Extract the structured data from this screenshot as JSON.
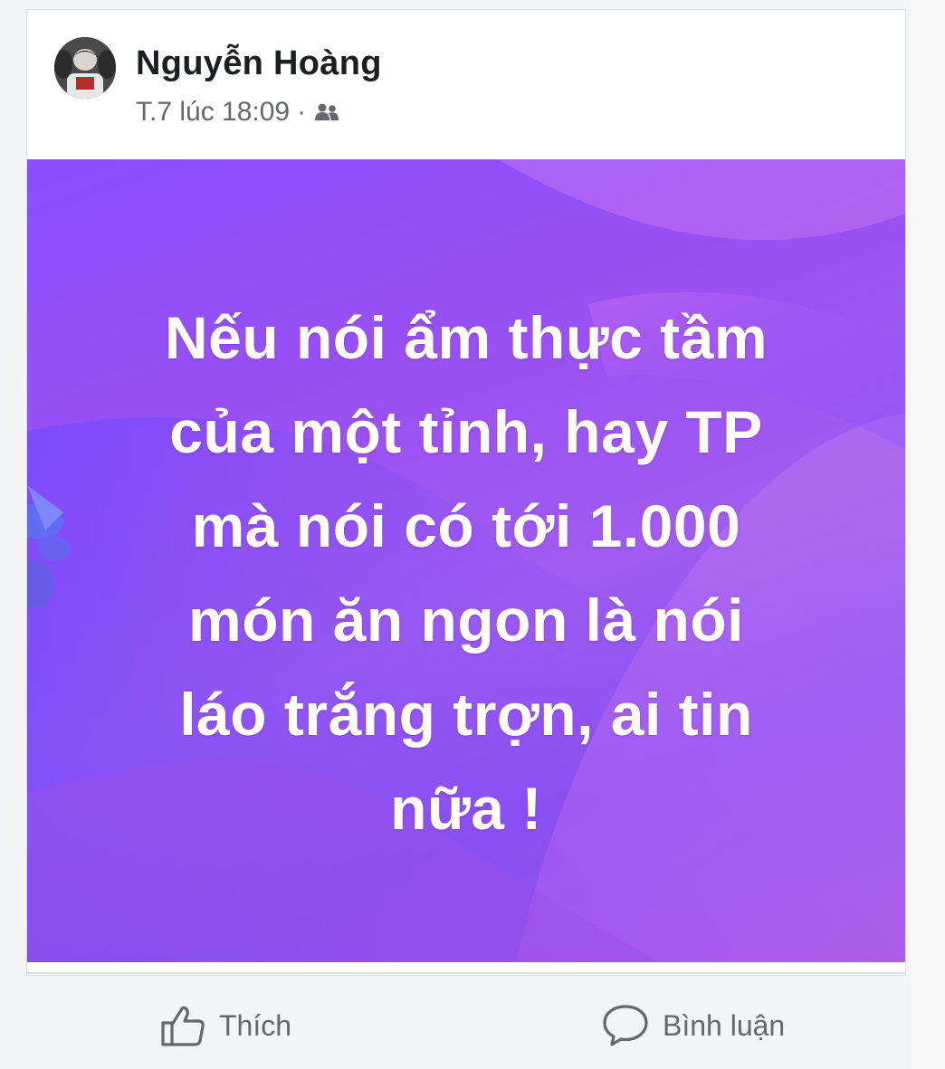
{
  "post": {
    "author": "Nguyễn Hoàng",
    "timestamp": "T.7 lúc 18:09",
    "separator": "·",
    "audience_icon": "friends-icon",
    "text": "Nếu nói ẩm thực tầm\ncủa một tỉnh, hay TP\nmà nói có tới 1.000\nmón ăn ngon là nói\nláo trắng trợn, ai tin\nnữa !",
    "background_colors": [
      "#8a4dff",
      "#a05cf0",
      "#9d4fe8"
    ]
  },
  "actions": {
    "like_label": "Thích",
    "comment_label": "Bình luận",
    "like_icon": "thumbs-up-icon",
    "comment_icon": "speech-bubble-icon"
  }
}
